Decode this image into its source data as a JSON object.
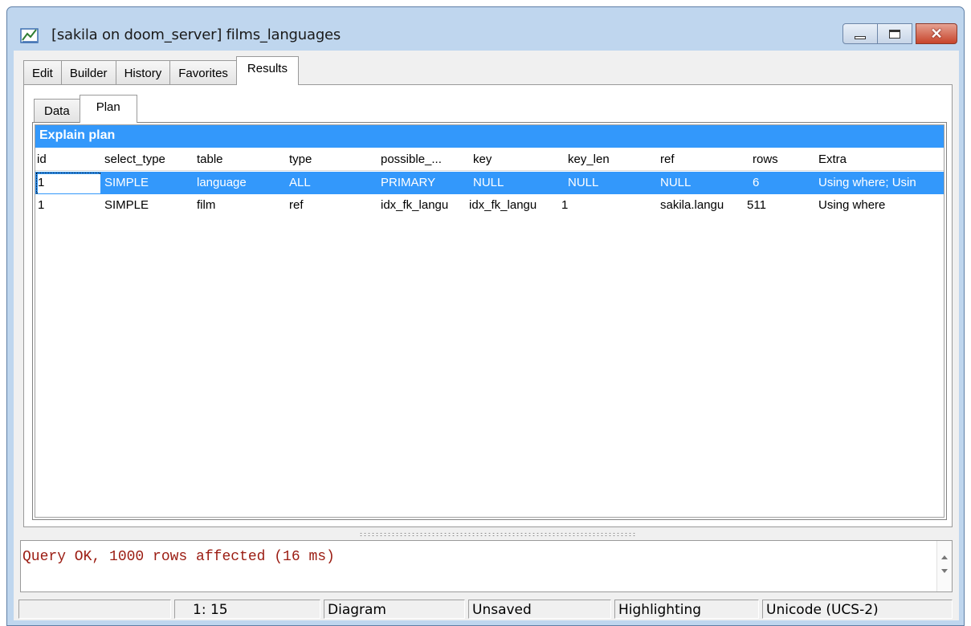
{
  "window": {
    "title": "[sakila on doom_server] films_languages",
    "app_icon": "query-builder-icon",
    "caption_buttons": [
      "minimize",
      "maximize",
      "close"
    ]
  },
  "outer_tabs": [
    "Edit",
    "Builder",
    "History",
    "Favorites",
    "Results"
  ],
  "outer_active": "Results",
  "inner_tabs": [
    "Data",
    "Plan"
  ],
  "inner_active": "Plan",
  "plan": {
    "header": "Explain plan",
    "columns": [
      "id",
      "select_type",
      "table",
      "type",
      "possible_...",
      "key",
      "key_len",
      "ref",
      "rows",
      "Extra"
    ],
    "rows": [
      [
        "1",
        "SIMPLE",
        "language",
        "ALL",
        "PRIMARY",
        "NULL",
        "NULL",
        "NULL",
        "6",
        "Using where; Usin"
      ],
      [
        "1",
        "SIMPLE",
        "film",
        "ref",
        "idx_fk_langu",
        "idx_fk_langu",
        "1",
        "sakila.langu",
        "511",
        "Using where"
      ]
    ]
  },
  "log": {
    "message": "Query OK, 1000 rows affected (16 ms)"
  },
  "status": {
    "panel1": "",
    "position": "1:  15",
    "mode": "Diagram",
    "saved": "Unsaved",
    "highlighting": "Highlighting",
    "encoding": "Unicode (UCS-2)"
  },
  "colors": {
    "selection": "#3398fb",
    "log_text": "#9b1c12",
    "frame": "#bfd6ee"
  }
}
